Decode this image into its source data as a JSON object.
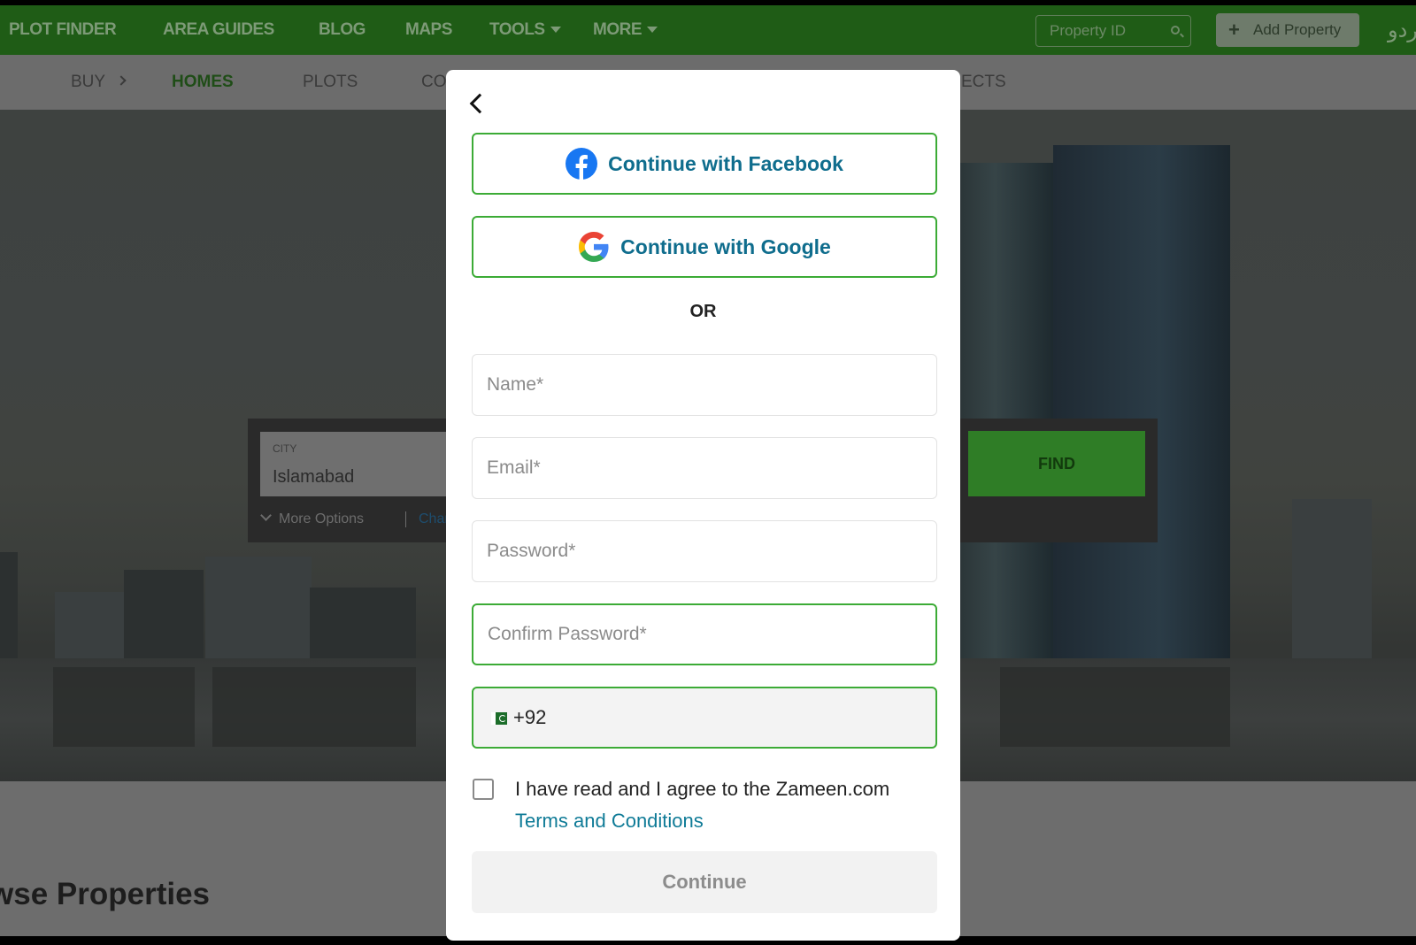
{
  "topnav": {
    "items": [
      {
        "label": "PLOT FINDER"
      },
      {
        "label": "AREA GUIDES"
      },
      {
        "label": "BLOG"
      },
      {
        "label": "MAPS"
      },
      {
        "label": "TOOLS"
      },
      {
        "label": "MORE"
      }
    ],
    "property_id_placeholder": "Property ID",
    "add_property_label": "Add Property",
    "language_toggle": "اردو"
  },
  "subnav": {
    "items": [
      {
        "label": "BUY"
      },
      {
        "label": "HOMES"
      },
      {
        "label": "PLOTS"
      },
      {
        "label": "CO"
      },
      {
        "label": "ECTS"
      }
    ]
  },
  "search": {
    "city_label": "CITY",
    "city_value": "Islamabad",
    "more_options_label": "More Options",
    "change_label": "Chan",
    "find_label": "FIND"
  },
  "section": {
    "title": "wse Properties"
  },
  "modal": {
    "facebook_label": "Continue with Facebook",
    "google_label": "Continue with Google",
    "or_text": "OR",
    "name_placeholder": "Name*",
    "email_placeholder": "Email*",
    "password_placeholder": "Password*",
    "confirm_password_placeholder": "Confirm Password*",
    "phone_code": "+92",
    "terms_prefix": "I have read and I agree to the Zameen.com",
    "terms_link": "Terms and Conditions",
    "continue_label": "Continue"
  },
  "colors": {
    "brand_green": "#3cab36",
    "link_teal": "#0f6d8d",
    "facebook_blue": "#1877f2"
  }
}
